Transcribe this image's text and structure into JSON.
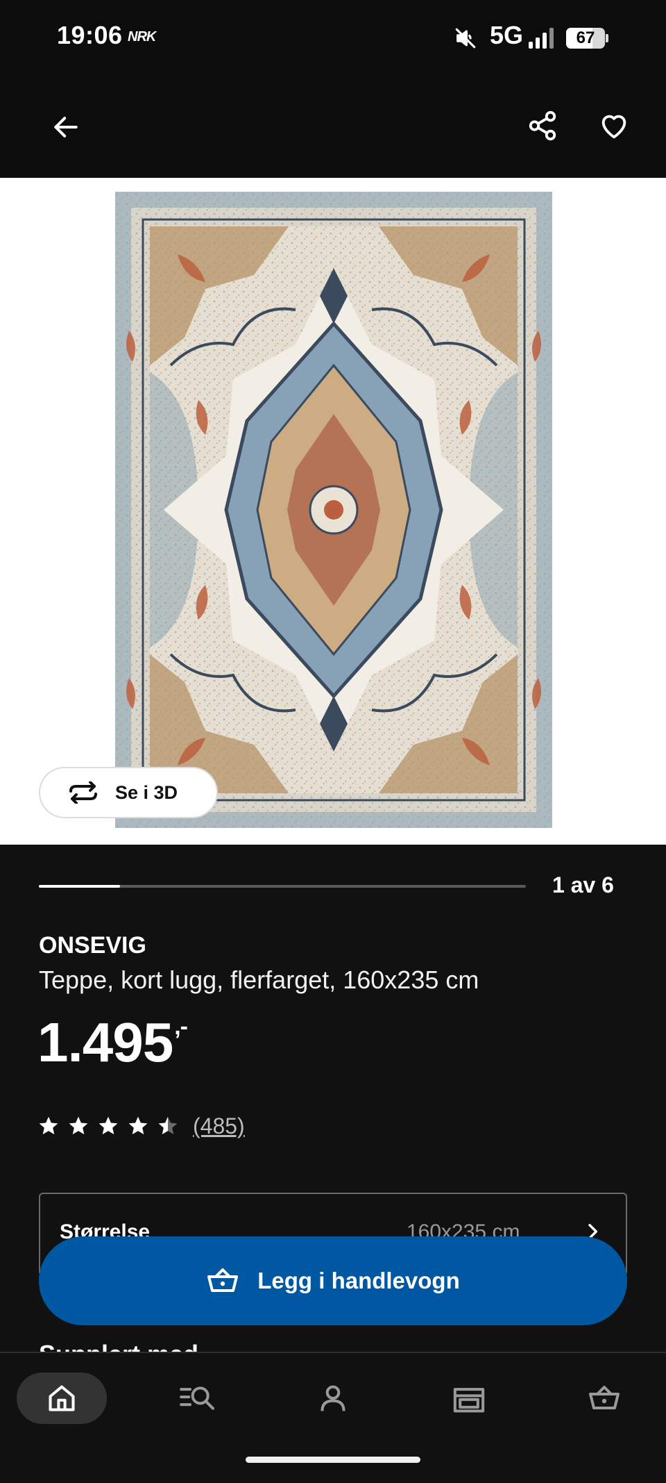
{
  "status_bar": {
    "time": "19:06",
    "carrier": "NRK",
    "network": "5G",
    "battery": "67",
    "battery_fraction": 0.67
  },
  "top_bar": {
    "icons": [
      "arrow-left-icon",
      "share-icon",
      "heart-icon"
    ]
  },
  "image_gallery": {
    "view_3d_label": "Se i 3D",
    "counter": "1 av 6",
    "current": 1,
    "total": 6
  },
  "product": {
    "name": "ONSEVIG",
    "description": "Teppe, kort lugg, flerfarget, 160x235 cm",
    "price": "1.495",
    "price_suffix": ",-",
    "rating": 4.5,
    "review_count": "(485)"
  },
  "size_selector": {
    "label": "Størrelse",
    "value": "160x235 cm"
  },
  "cart_button": {
    "label": "Legg i handlevogn"
  },
  "section_heading": "Supplert med",
  "bottom_nav": {
    "items": [
      "home-icon",
      "search-icon",
      "profile-icon",
      "store-icon",
      "cart-icon"
    ],
    "active": "home"
  },
  "colors": {
    "background": "#111111",
    "cart_button": "#0058a3",
    "rug_field": "#efe9dd",
    "rug_blue": "#6f90a6",
    "rug_tan": "#b08a5a",
    "rug_rust": "#b5532e",
    "rug_navy": "#2b3b4f"
  }
}
